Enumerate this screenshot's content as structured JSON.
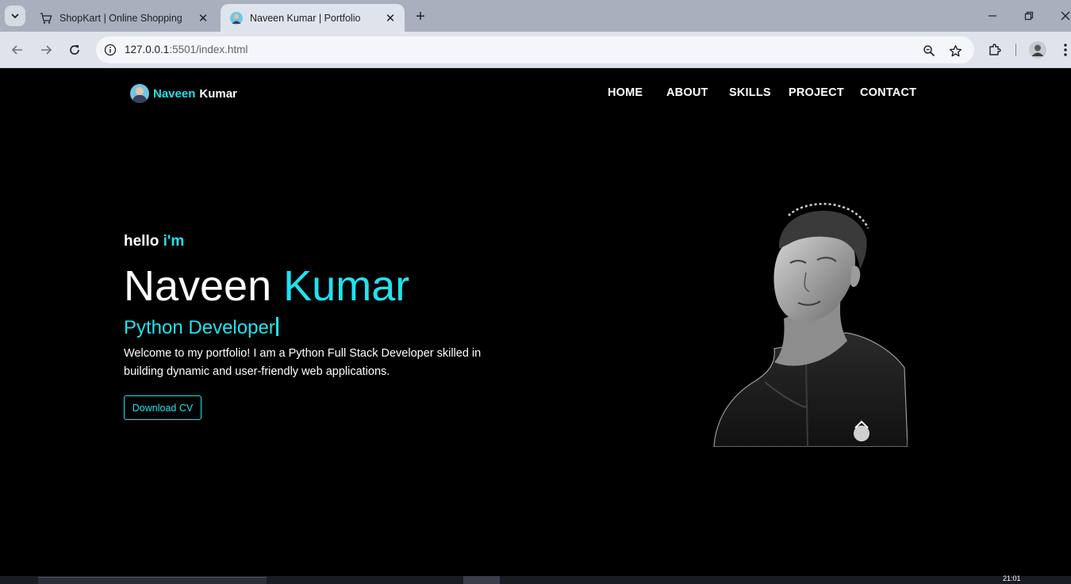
{
  "browser": {
    "tabs": [
      {
        "title": "ShopKart | Online Shopping",
        "active": false,
        "icon": "cart-icon"
      },
      {
        "title": "Naveen Kumar | Portfolio",
        "active": true,
        "icon": "avatar-icon"
      }
    ],
    "url_host": "127.0.0.1",
    "url_rest": ":5501/index.html"
  },
  "site": {
    "brand_first": "Naveen",
    "brand_last": "Kumar",
    "nav": [
      "HOME",
      "ABOUT",
      "SKILLS",
      "PROJECT",
      "CONTACT"
    ],
    "hero": {
      "greeting": "hello",
      "greeting_accent": "i'm",
      "name_first": "Naveen",
      "name_last": "Kumar",
      "role": "Python Developer",
      "description": "Welcome to my portfolio! I am a Python Full Stack Developer skilled in building dynamic and user-friendly web applications.",
      "cta": "Download CV"
    }
  },
  "taskbar": {
    "clock": "21:01"
  },
  "colors": {
    "accent": "#1ee3ef",
    "background": "#000000",
    "chrome": "#dfe3eb",
    "tabstrip": "#a9afbd"
  }
}
